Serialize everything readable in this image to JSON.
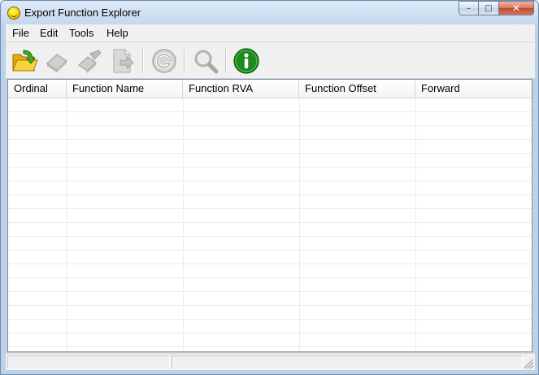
{
  "window": {
    "title": "Export Function Explorer",
    "caption": {
      "minimize": "–",
      "maximize": "□",
      "close": "✕"
    }
  },
  "menubar": {
    "items": [
      {
        "label": "File"
      },
      {
        "label": "Edit"
      },
      {
        "label": "Tools"
      },
      {
        "label": "Help"
      }
    ]
  },
  "toolbar": {
    "buttons": [
      {
        "icon": "open-folder-icon",
        "enabled": true
      },
      {
        "icon": "eraser-icon",
        "enabled": false
      },
      {
        "icon": "eraser-edit-icon",
        "enabled": false
      },
      {
        "icon": "export-document-icon",
        "enabled": false
      },
      {
        "icon": "google-search-icon",
        "enabled": false
      },
      {
        "icon": "magnifier-icon",
        "enabled": false
      },
      {
        "icon": "info-icon",
        "enabled": true
      }
    ],
    "colors": {
      "folder": "#f2c21b",
      "arrow": "#3b9e1f",
      "info": "#1f8a1f",
      "disabled": "#b8b8b8"
    }
  },
  "list": {
    "columns": [
      {
        "label": "Ordinal"
      },
      {
        "label": "Function Name"
      },
      {
        "label": "Function RVA"
      },
      {
        "label": "Function Offset"
      },
      {
        "label": "Forward"
      }
    ],
    "rows": []
  },
  "statusbar": {
    "panels": [
      "",
      ""
    ]
  }
}
